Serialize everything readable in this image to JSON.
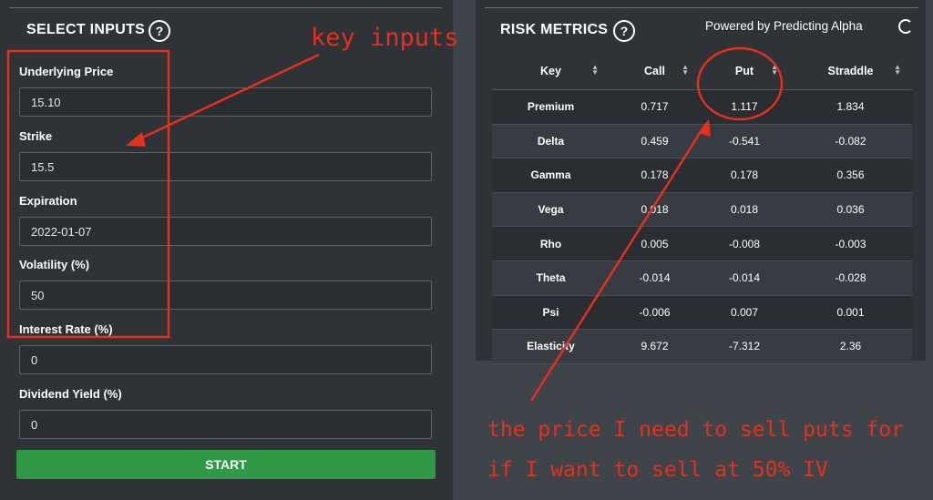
{
  "inputs_panel": {
    "title": "SELECT INPUTS",
    "help_icon": "help-circle-icon",
    "fields": [
      {
        "label": "Underlying Price",
        "value": "15.10"
      },
      {
        "label": "Strike",
        "value": "15.5"
      },
      {
        "label": "Expiration",
        "value": "2022-01-07"
      },
      {
        "label": "Volatility (%)",
        "value": "50"
      },
      {
        "label": "Interest Rate (%)",
        "value": "0"
      },
      {
        "label": "Dividend Yield (%)",
        "value": "0"
      }
    ],
    "start_label": "START"
  },
  "metrics_panel": {
    "title": "RISK METRICS",
    "help_icon": "help-circle-icon",
    "powered_by": "Powered by Predicting Alpha",
    "logo_icon": "predicting-alpha-logo-icon",
    "columns": [
      "Key",
      "Call",
      "Put",
      "Straddle"
    ],
    "sort_icon": "sort-arrows-icon",
    "rows": [
      {
        "key": "Premium",
        "call": "0.717",
        "put": "1.117",
        "straddle": "1.834"
      },
      {
        "key": "Delta",
        "call": "0.459",
        "put": "-0.541",
        "straddle": "-0.082"
      },
      {
        "key": "Gamma",
        "call": "0.178",
        "put": "0.178",
        "straddle": "0.356"
      },
      {
        "key": "Vega",
        "call": "0.018",
        "put": "0.018",
        "straddle": "0.036"
      },
      {
        "key": "Rho",
        "call": "0.005",
        "put": "-0.008",
        "straddle": "-0.003"
      },
      {
        "key": "Theta",
        "call": "-0.014",
        "put": "-0.014",
        "straddle": "-0.028"
      },
      {
        "key": "Psi",
        "call": "-0.006",
        "put": "0.007",
        "straddle": "0.001"
      },
      {
        "key": "Elasticity",
        "call": "9.672",
        "put": "-7.312",
        "straddle": "2.36"
      }
    ]
  },
  "annotations": {
    "key_inputs": "key inputs",
    "note_line1": "the price I need to sell puts for",
    "note_line2": "if I want to sell at 50% IV",
    "color": "#e5301b"
  },
  "colors": {
    "background": "#3f444b",
    "panel": "#2f3237",
    "start_button": "#2e9a45"
  }
}
